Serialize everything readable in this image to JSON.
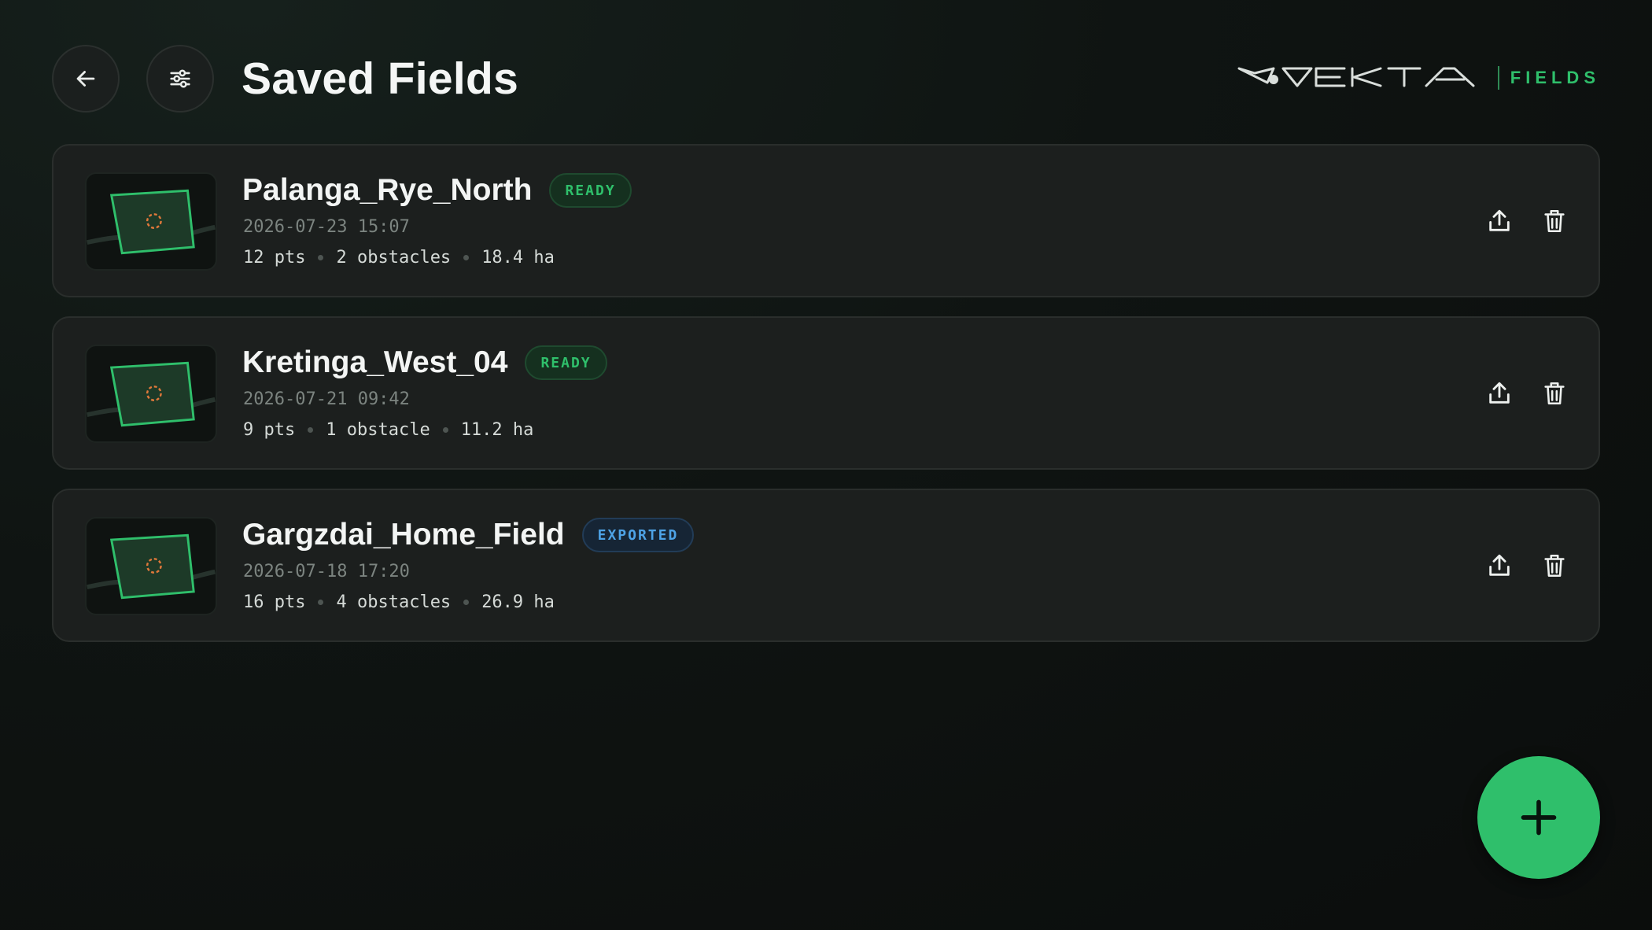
{
  "header": {
    "title": "Saved Fields",
    "back_icon": "arrow-left-icon",
    "filter_icon": "sliders-icon",
    "logo_text": "VEKTA",
    "logo_sub": "FIELDS"
  },
  "colors": {
    "accent": "#2fbf6b",
    "ready": "#2fbf6b",
    "exported": "#4ea3e6",
    "obstacle": "#e0783a"
  },
  "fields": [
    {
      "name": "Palanga_Rye_North",
      "status": "READY",
      "status_type": "ready",
      "date": "2026-07-23 15:07",
      "points": "12 pts",
      "obstacles": "2 obstacles",
      "area": "18.4 ha"
    },
    {
      "name": "Kretinga_West_04",
      "status": "READY",
      "status_type": "ready",
      "date": "2026-07-21 09:42",
      "points": "9 pts",
      "obstacles": "1 obstacle",
      "area": "11.2 ha"
    },
    {
      "name": "Gargzdai_Home_Field",
      "status": "EXPORTED",
      "status_type": "exported",
      "date": "2026-07-18 17:20",
      "points": "16 pts",
      "obstacles": "4 obstacles",
      "area": "26.9 ha"
    }
  ],
  "actions": {
    "share_icon": "share-upload-icon",
    "delete_icon": "trash-icon",
    "add_icon": "plus-icon"
  }
}
